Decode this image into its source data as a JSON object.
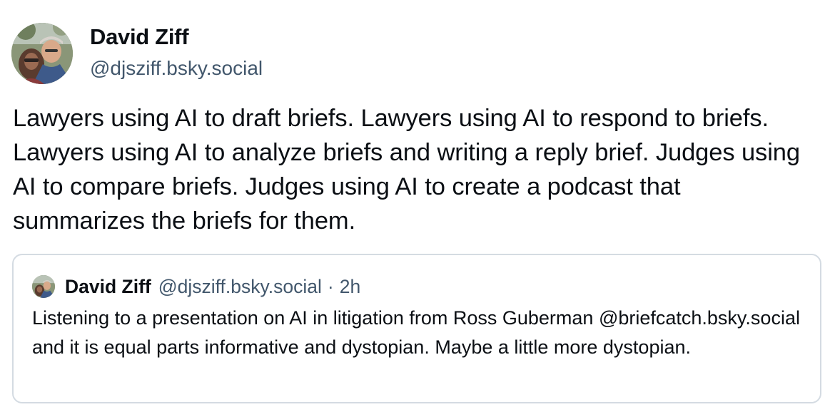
{
  "post": {
    "author": {
      "display_name": "David Ziff",
      "handle": "@djsziff.bsky.social"
    },
    "text": "Lawyers using AI to draft briefs. Lawyers using AI to respond to briefs. Lawyers using AI to analyze briefs and writing a reply brief. Judges using AI to compare briefs. Judges using AI to create a podcast that summarizes the briefs for them."
  },
  "quoted_post": {
    "author": {
      "display_name": "David Ziff",
      "handle": "@djsziff.bsky.social"
    },
    "separator": "·",
    "timestamp": "2h",
    "text": "Listening to a presentation on AI in litigation from Ross Guberman @briefcatch.bsky.social and it is equal parts informative and dystopian. Maybe a little more dystopian."
  },
  "colors": {
    "primary_text": "#0b0f14",
    "secondary_text": "#42576c",
    "card_border": "#d4dbe2"
  }
}
